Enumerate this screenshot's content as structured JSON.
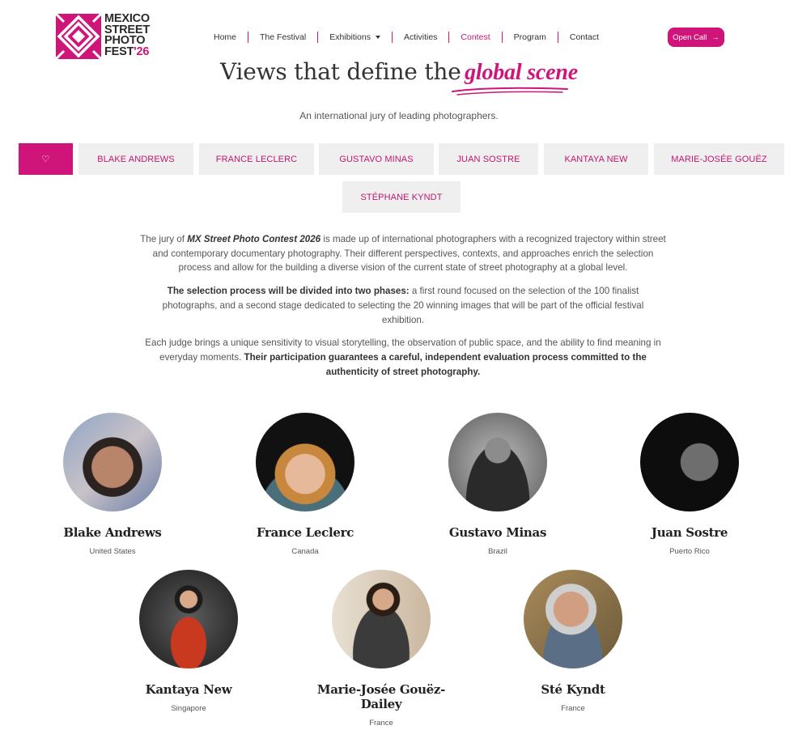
{
  "logo": {
    "line1": "MEXICO",
    "line2": "STREET",
    "line3": "PHOTO",
    "line4_text": "FEST",
    "line4_year": "'26",
    "brand_color": "#d0157a"
  },
  "nav": {
    "items": [
      {
        "label": "Home"
      },
      {
        "label": "The Festival"
      },
      {
        "label": "Exhibitions"
      },
      {
        "label": "Activities"
      },
      {
        "label": "Contest"
      },
      {
        "label": "Program"
      },
      {
        "label": "Contact"
      }
    ],
    "active": "Contest",
    "cta_label": "Open Call",
    "cta_icon": "arrow-right-icon"
  },
  "hero": {
    "title_plain": "Views that define the",
    "title_accent": "global scene",
    "subtitle": "An international jury of leading photographers."
  },
  "tabs": {
    "heart_icon": "heart-icon",
    "labels": [
      "Blake Andrews",
      "France Leclerc",
      "Gustavo Minas",
      "Juan Sostre",
      "Kantaya New",
      "Marie-Josée Gouëz",
      "Stéphane Kyndt"
    ]
  },
  "intro": {
    "p1_pre": "The jury of ",
    "p1_em": "MX Street Photo Contest 2026",
    "p1_post": " is made up of international photographers with a recognized trajectory within street and contemporary documentary photography. Their different perspectives, contexts, and approaches enrich the selection process and allow for the building a diverse vision of the current state of street photography at a global level.",
    "p2_bold": "The selection process will be divided into two phases:",
    "p2_rest": " a first round focused on the selection of the 100 finalist photographs, and a second stage dedicated to selecting the 20 winning images that will be part of the official festival exhibition.",
    "p3_pre": "Each judge brings a unique sensitivity to visual storytelling, the observation of public space, and the ability to find meaning in everyday moments. ",
    "p3_bold": "Their participation guarantees a careful, independent evaluation process committed to the authenticity of street photography."
  },
  "jury": [
    {
      "name": "Blake Andrews",
      "country": "United States"
    },
    {
      "name": "France Leclerc",
      "country": "Canada"
    },
    {
      "name": "Gustavo Minas",
      "country": "Brazil"
    },
    {
      "name": "Juan Sostre",
      "country": "Puerto Rico"
    },
    {
      "name": "Kantaya New",
      "country": "Singapore"
    },
    {
      "name": "Marie-Josée Gouëz-Dailey",
      "country": "France"
    },
    {
      "name": "Sté Kyndt",
      "country": "France"
    }
  ]
}
